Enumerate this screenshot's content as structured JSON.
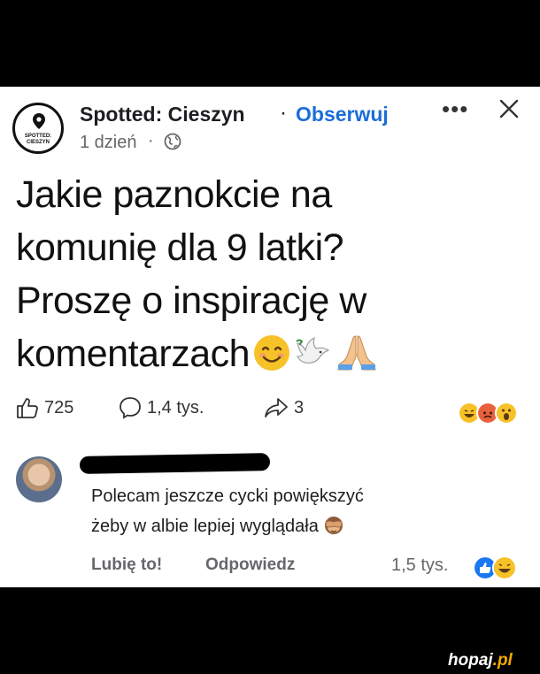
{
  "page": {
    "name": "Spotted: Cieszyn",
    "separator": "·",
    "follow_label": "Obserwuj",
    "more_label": "•••",
    "logo_text_line1": "SPOTTED:",
    "logo_text_line2": "CIESZYN",
    "time": "1 dzień",
    "time_separator": "·"
  },
  "post": {
    "line1": "Jakie paznokcie na",
    "line2": "komunię dla 9 latki?",
    "line3": "Proszę o inspirację w",
    "line4": "komentarzach"
  },
  "stats": {
    "likes": "725",
    "comments": "1,4 tys.",
    "shares": "3"
  },
  "comment": {
    "text_line1": "Polecam jeszcze cycki powiększyć",
    "text_line2": "żeby w albie lepiej wyglądała",
    "like_label": "Lubię to!",
    "reply_label": "Odpowiedz",
    "reaction_count": "1,5 tys."
  },
  "watermark": {
    "main": "hopaj",
    "suffix": ".pl"
  },
  "colors": {
    "accent": "#1a6ed8",
    "meta": "#65676b"
  }
}
